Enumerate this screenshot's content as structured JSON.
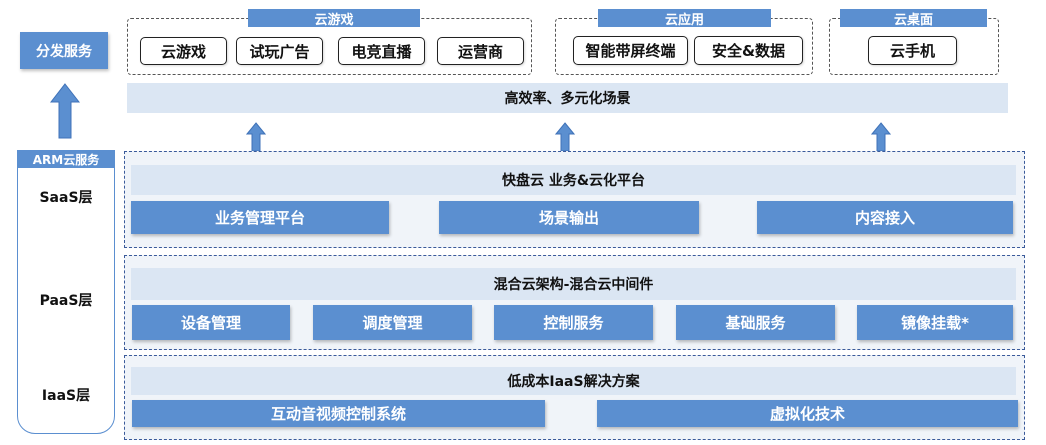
{
  "left": {
    "dist_service": "分发服务",
    "arm_header": "ARM云服务",
    "saas": "SaaS层",
    "paas": "PaaS层",
    "iaas": "IaaS层"
  },
  "top_groups": {
    "cloud_game": {
      "header": "云游戏",
      "items": [
        "云游戏",
        "试玩广告",
        "电竞直播",
        "运营商"
      ]
    },
    "cloud_app": {
      "header": "云应用",
      "items": [
        "智能带屏终端",
        "安全&数据"
      ]
    },
    "cloud_desktop": {
      "header": "云桌面",
      "items": [
        "云手机"
      ]
    }
  },
  "scenario_bar": "高效率、多元化场景",
  "saas_layer": {
    "title": "快盘云 业务&云化平台",
    "modules": [
      "业务管理平台",
      "场景输出",
      "内容接入"
    ]
  },
  "paas_layer": {
    "title": "混合云架构-混合云中间件",
    "modules": [
      "设备管理",
      "调度管理",
      "控制服务",
      "基础服务",
      "镜像挂载*"
    ]
  },
  "iaas_layer": {
    "title": "低成本IaaS解决方案",
    "modules": [
      "互动音视频控制系统",
      "虚拟化技术"
    ]
  },
  "colors": {
    "accent_blue": "#5b8fd0",
    "light_bar": "#dbe6f3",
    "layer_bg": "#f0f4f9",
    "arrow": "#5b8fd0"
  }
}
